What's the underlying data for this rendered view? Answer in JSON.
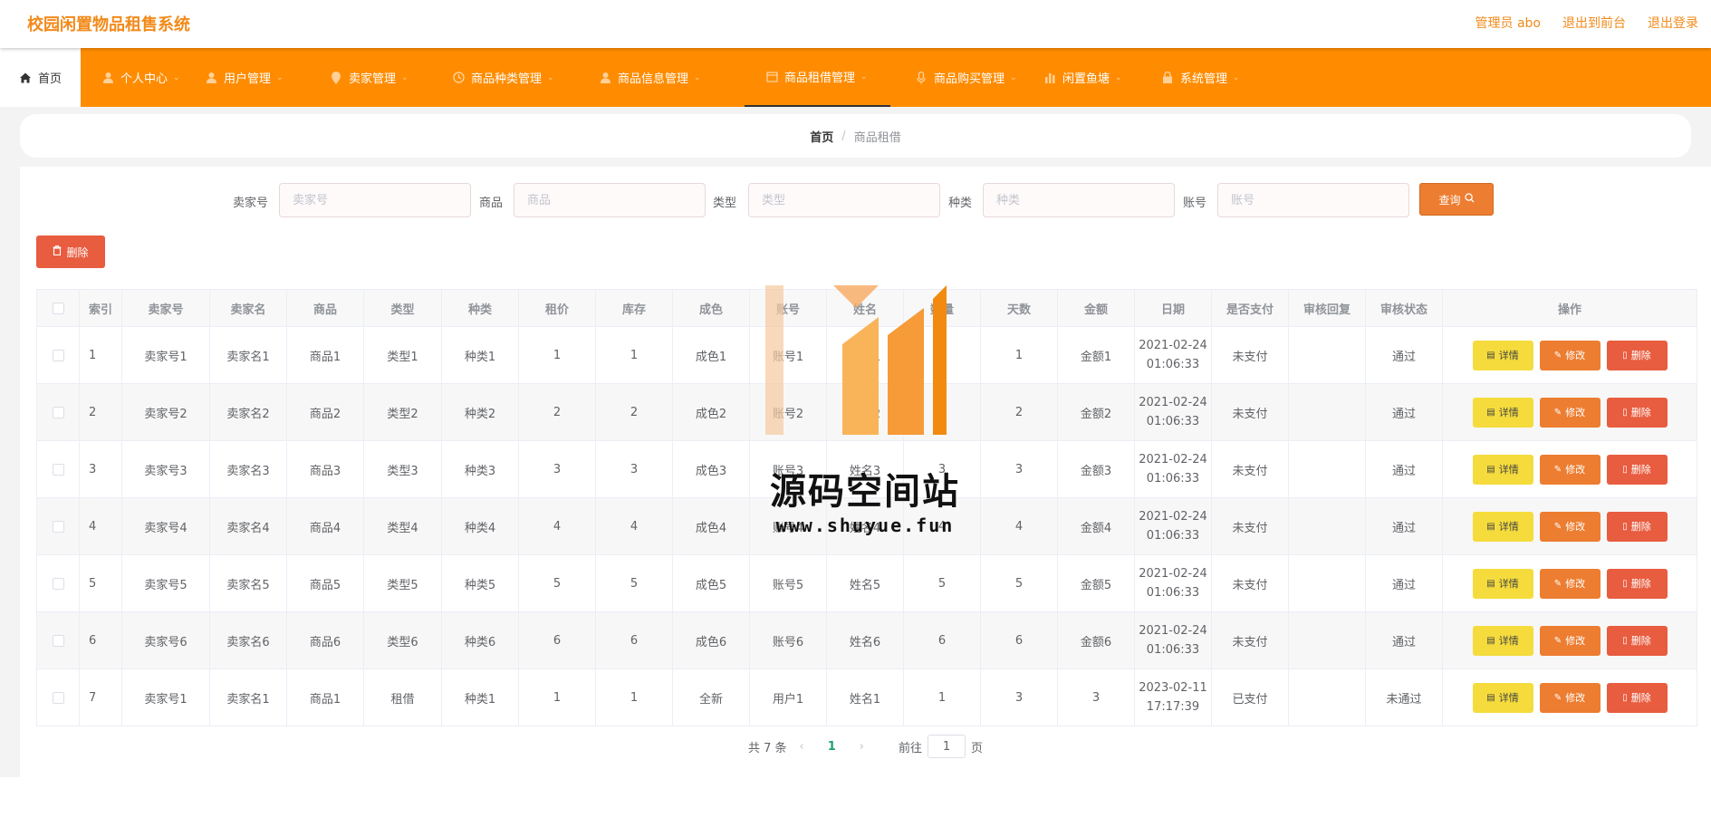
{
  "header": {
    "title": "校园闲置物品租售系统",
    "links": [
      "管理员 abo",
      "退出到前台",
      "退出登录"
    ]
  },
  "nav": [
    {
      "label": "首页",
      "icon": "home-icon"
    },
    {
      "label": "个人中心",
      "icon": "user-icon"
    },
    {
      "label": "用户管理",
      "icon": "user-icon"
    },
    {
      "label": "卖家管理",
      "icon": "pin-icon"
    },
    {
      "label": "商品种类管理",
      "icon": "clock-icon"
    },
    {
      "label": "商品信息管理",
      "icon": "user-icon"
    },
    {
      "label": "商品租借管理",
      "icon": "calendar-icon"
    },
    {
      "label": "商品购买管理",
      "icon": "mic-icon"
    },
    {
      "label": "闲置鱼塘",
      "icon": "bar-chart-icon"
    },
    {
      "label": "系统管理",
      "icon": "lock-icon"
    }
  ],
  "breadcrumb": {
    "home": "首页",
    "separator": "/",
    "current": "商品租借"
  },
  "search": {
    "fields": [
      {
        "label": "卖家号",
        "placeholder": "卖家号"
      },
      {
        "label": "商品",
        "placeholder": "商品"
      },
      {
        "label": "类型",
        "placeholder": "类型"
      },
      {
        "label": "种类",
        "placeholder": "种类"
      },
      {
        "label": "账号",
        "placeholder": "账号"
      }
    ],
    "query_label": "查询"
  },
  "toolbar": {
    "delete_label": "删除"
  },
  "table": {
    "headers": [
      "",
      "索引",
      "卖家号",
      "卖家名",
      "商品",
      "类型",
      "种类",
      "租价",
      "库存",
      "成色",
      "账号",
      "姓名",
      "数量",
      "天数",
      "金额",
      "日期",
      "是否支付",
      "审核回复",
      "审核状态",
      "操作"
    ],
    "rows": [
      [
        "1",
        "卖家号1",
        "卖家名1",
        "商品1",
        "类型1",
        "种类1",
        "1",
        "1",
        "成色1",
        "账号1",
        "姓名1",
        "1",
        "1",
        "金额1",
        "2021-02-24 01:06:33",
        "未支付",
        "",
        "通过"
      ],
      [
        "2",
        "卖家号2",
        "卖家名2",
        "商品2",
        "类型2",
        "种类2",
        "2",
        "2",
        "成色2",
        "账号2",
        "姓名2",
        "2",
        "2",
        "金额2",
        "2021-02-24 01:06:33",
        "未支付",
        "",
        "通过"
      ],
      [
        "3",
        "卖家号3",
        "卖家名3",
        "商品3",
        "类型3",
        "种类3",
        "3",
        "3",
        "成色3",
        "账号3",
        "姓名3",
        "3",
        "3",
        "金额3",
        "2021-02-24 01:06:33",
        "未支付",
        "",
        "通过"
      ],
      [
        "4",
        "卖家号4",
        "卖家名4",
        "商品4",
        "类型4",
        "种类4",
        "4",
        "4",
        "成色4",
        "账号4",
        "姓名4",
        "4",
        "4",
        "金额4",
        "2021-02-24 01:06:33",
        "未支付",
        "",
        "通过"
      ],
      [
        "5",
        "卖家号5",
        "卖家名5",
        "商品5",
        "类型5",
        "种类5",
        "5",
        "5",
        "成色5",
        "账号5",
        "姓名5",
        "5",
        "5",
        "金额5",
        "2021-02-24 01:06:33",
        "未支付",
        "",
        "通过"
      ],
      [
        "6",
        "卖家号6",
        "卖家名6",
        "商品6",
        "类型6",
        "种类6",
        "6",
        "6",
        "成色6",
        "账号6",
        "姓名6",
        "6",
        "6",
        "金额6",
        "2021-02-24 01:06:33",
        "未支付",
        "",
        "通过"
      ],
      [
        "7",
        "卖家号1",
        "卖家名1",
        "商品1",
        "租借",
        "种类1",
        "1",
        "1",
        "全新",
        "用户1",
        "姓名1",
        "1",
        "3",
        "3",
        "2023-02-11 17:17:39",
        "已支付",
        "",
        "未通过"
      ]
    ],
    "actions": [
      "详情",
      "修改",
      "删除"
    ]
  },
  "pagination": {
    "total": "共 7 条",
    "current_page": "1",
    "goto_prefix": "前往",
    "goto_value": "1",
    "goto_suffix": "页"
  },
  "watermark": {
    "text": "源码空间站",
    "url": "www.shuyue.fun"
  },
  "colors": {
    "brand": "#ff8c00",
    "title": "#f28a1a",
    "query": "#ed7d31",
    "delete": "#e85c3f",
    "detail": "#f5dc3c"
  }
}
